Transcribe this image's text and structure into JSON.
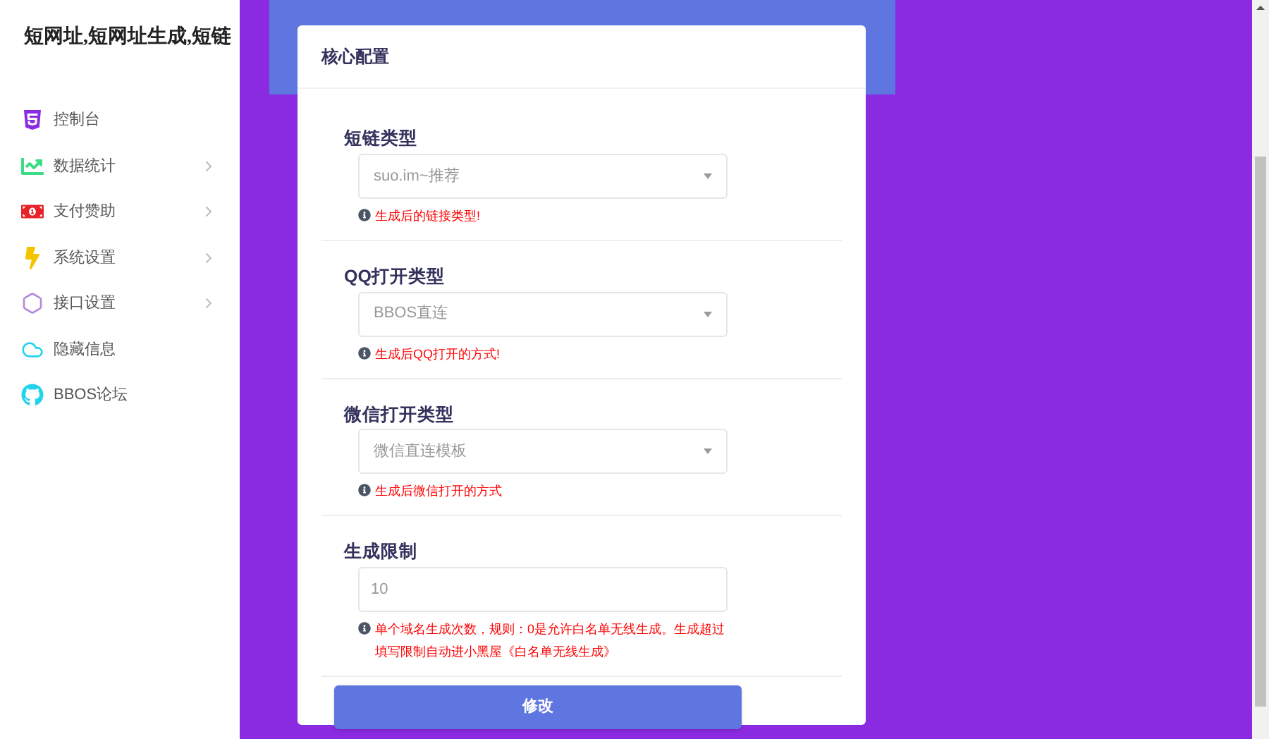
{
  "sidebar": {
    "title": "短网址,短网址生成,短链",
    "items": [
      {
        "label": "控制台",
        "expandable": false
      },
      {
        "label": "数据统计",
        "expandable": true
      },
      {
        "label": "支付赞助",
        "expandable": true
      },
      {
        "label": "系统设置",
        "expandable": true
      },
      {
        "label": "接口设置",
        "expandable": true
      },
      {
        "label": "隐藏信息",
        "expandable": false
      },
      {
        "label": "BBOS论坛",
        "expandable": false
      }
    ]
  },
  "card": {
    "title": "核心配置",
    "fields": [
      {
        "kind": "select",
        "label": "短链类型",
        "value": "suo.im~推荐",
        "hint": "生成后的链接类型!"
      },
      {
        "kind": "select",
        "label": "QQ打开类型",
        "value": "BBOS直连",
        "hint": "生成后QQ打开的方式!"
      },
      {
        "kind": "select",
        "label": "微信打开类型",
        "value": "微信直连模板",
        "hint": "生成后微信打开的方式"
      },
      {
        "kind": "input",
        "label": "生成限制",
        "value": "10",
        "hint": "单个域名生成次数，规则：0是允许白名单无线生成。生成超过填写限制自动进小黑屋《白名单无线生成》"
      }
    ],
    "submit": "修改"
  }
}
